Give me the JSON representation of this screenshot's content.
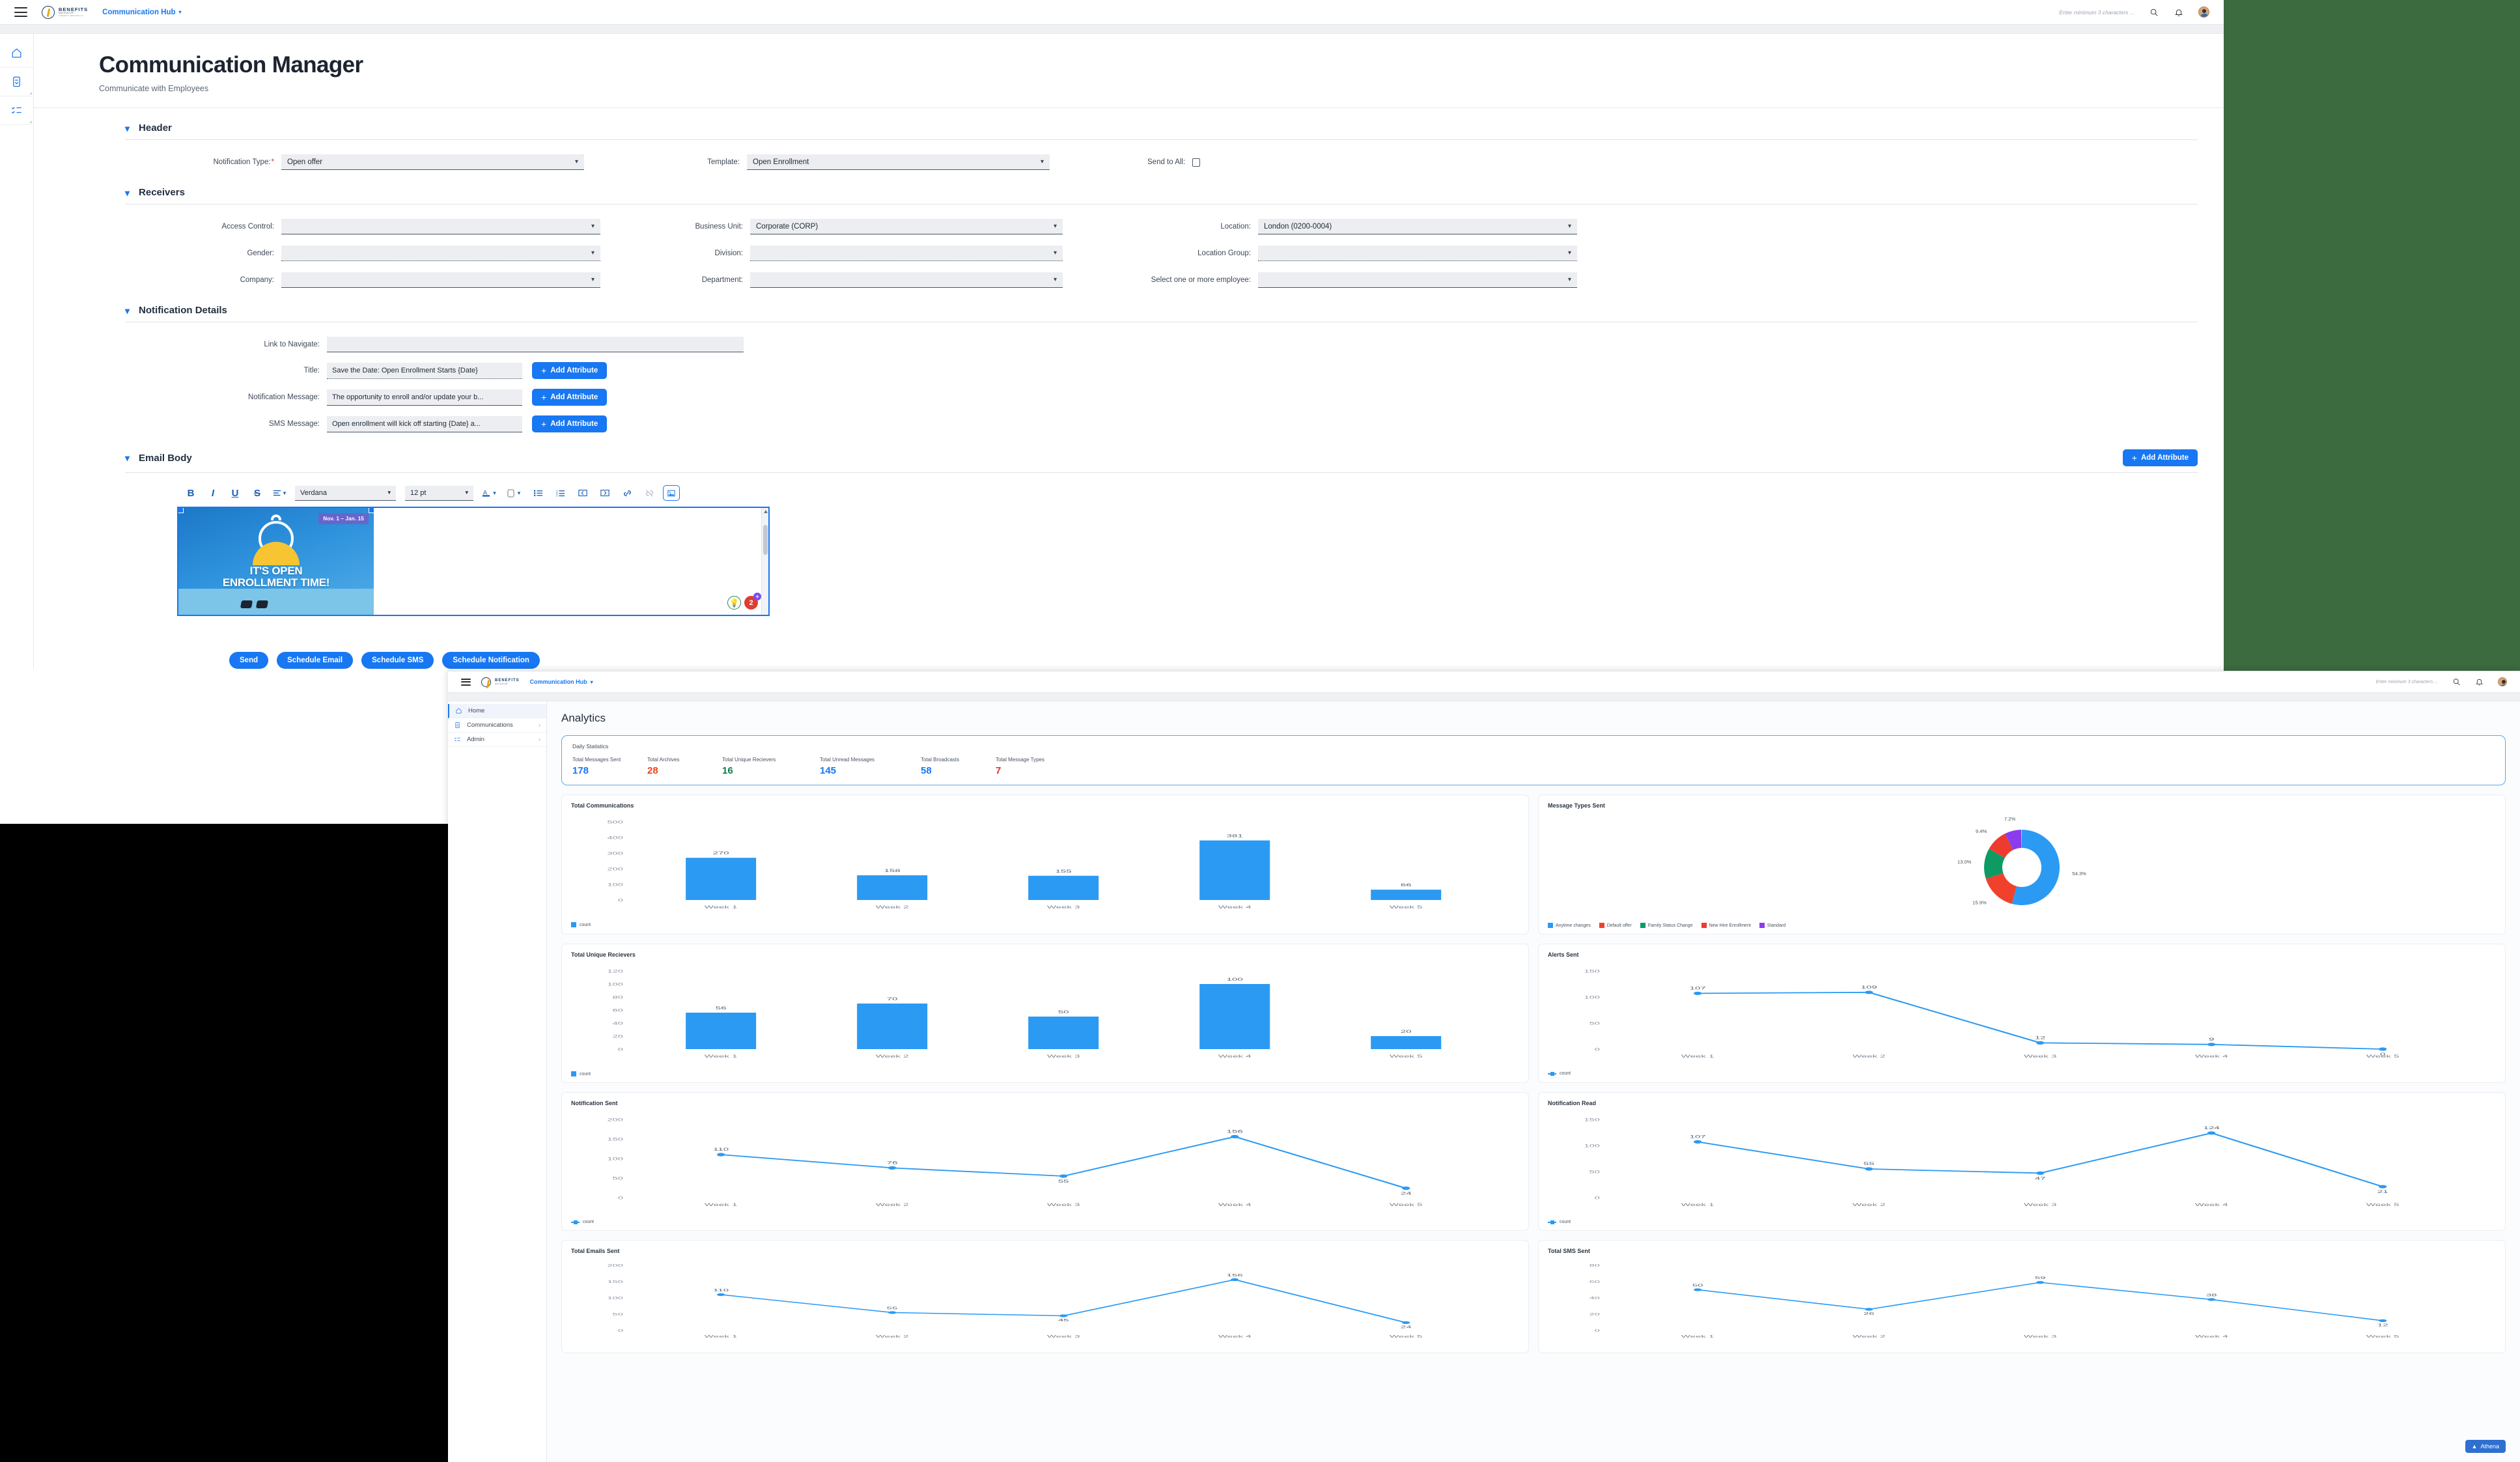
{
  "back_window": {
    "topbar": {
      "brand_line1": "BENEFITS",
      "brand_line2": "NAVIGATOR",
      "brand_line3": "A BENEFIT SERVICES CO",
      "hub_label": "Communication Hub",
      "search_placeholder": "Enter minimum 3 characters ..."
    },
    "page_title": "Communication Manager",
    "page_subtitle": "Communicate with Employees",
    "sections": {
      "header": "Header",
      "receivers": "Receivers",
      "notification_details": "Notification Details",
      "email_body": "Email Body"
    },
    "header_fields": {
      "notification_type_label": "Notification Type:",
      "notification_type_value": "Open offer",
      "template_label": "Template:",
      "template_value": "Open Enrollment",
      "send_to_all_label": "Send to All:"
    },
    "receivers_fields": {
      "access_control_label": "Access Control:",
      "access_control_value": "",
      "gender_label": "Gender:",
      "gender_value": "",
      "company_label": "Company:",
      "company_value": "",
      "business_unit_label": "Business Unit:",
      "business_unit_value": "Corporate (CORP)",
      "division_label": "Division:",
      "division_value": "",
      "department_label": "Department:",
      "department_value": "",
      "location_label": "Location:",
      "location_value": "London (0200-0004)",
      "location_group_label": "Location Group:",
      "location_group_value": "",
      "employee_label": "Select one or more employee:",
      "employee_value": ""
    },
    "notification_fields": {
      "link_label": "Link to Navigate:",
      "link_value": "",
      "title_label": "Title:",
      "title_value": "Save the Date: Open Enrollment Starts  {Date}",
      "notification_message_label": "Notification Message:",
      "notification_message_value": "The opportunity to enroll and/or update your b...",
      "sms_message_label": "SMS Message:",
      "sms_message_value": "Open enrollment will kick off starting  {Date} a...",
      "add_attribute": "Add Attribute"
    },
    "email_body": {
      "add_attribute": "Add Attribute",
      "font_family": "Verdana",
      "font_size": "12 pt",
      "banner_date": "Nov. 1 – Jan. 15",
      "banner_line1": "IT'S OPEN",
      "banner_line2": "ENROLLMENT TIME!",
      "fab_badge": "2"
    },
    "actions": [
      "Send",
      "Schedule Email",
      "Schedule SMS",
      "Schedule Notification"
    ]
  },
  "front_window": {
    "topbar": {
      "brand_line1": "BENEFITS",
      "brand_line2": "NAVIGATOR",
      "hub_label": "Communication Hub",
      "search_placeholder": "Enter minimum 3 characters ..."
    },
    "sidebar": [
      {
        "label": "Home",
        "icon": "home-icon",
        "arrow": "",
        "active": true
      },
      {
        "label": "Communications",
        "icon": "clipboard-icon",
        "arrow": "›",
        "active": false
      },
      {
        "label": "Admin",
        "icon": "checklist-icon",
        "arrow": "›",
        "active": false
      }
    ],
    "title": "Analytics",
    "daily_statistics": {
      "label": "Daily Statistics",
      "items": [
        {
          "label": "Total Messages Sent",
          "value": "178",
          "color": "#1877f2"
        },
        {
          "label": "Total Archives",
          "value": "28",
          "color": "#e8451f"
        },
        {
          "label": "Total Unique Recievers",
          "value": "16",
          "color": "#0e7a4d"
        },
        {
          "label": "Total Unread Messages",
          "value": "145",
          "color": "#1877f2"
        },
        {
          "label": "Total Broadcasts",
          "value": "58",
          "color": "#1877f2"
        },
        {
          "label": "Total Message Types",
          "value": "7",
          "color": "#d93025"
        }
      ]
    },
    "taskbar_button": "Athena"
  },
  "chart_data": [
    {
      "type": "bar",
      "title": "Total Communications",
      "categories": [
        "Week 1",
        "Week 2",
        "Week 3",
        "Week 4",
        "Week 5"
      ],
      "values": [
        270,
        158,
        155,
        381,
        66
      ],
      "yticks": [
        0,
        100,
        200,
        300,
        400,
        500
      ],
      "ylim": [
        0,
        500
      ],
      "legend": [
        "count"
      ],
      "legend_position": "bottom-left",
      "color": "#2b9af3",
      "xlabel": "",
      "ylabel": ""
    },
    {
      "type": "pie",
      "title": "Message Types Sent",
      "labels": [
        "Anytime changes",
        "Default offer",
        "Family Status Change",
        "New Hire Enrollment",
        "Standard"
      ],
      "values": [
        54.3,
        15.9,
        13.0,
        9.4,
        7.2
      ],
      "display": [
        "54.3%",
        "15.9%",
        "13.0%",
        "9.4%",
        "7.2%"
      ],
      "colors": [
        "#2b9af3",
        "#f0412c",
        "#0e9b63",
        "#ee3b30",
        "#8a3ded"
      ],
      "donut": true,
      "legend_position": "bottom-left"
    },
    {
      "type": "bar",
      "title": "Total Unique Recievers",
      "categories": [
        "Week 1",
        "Week 2",
        "Week 3",
        "Week 4",
        "Week 5"
      ],
      "values": [
        56,
        70,
        50,
        100,
        20
      ],
      "yticks": [
        0,
        20,
        40,
        60,
        80,
        100,
        120
      ],
      "ylim": [
        0,
        120
      ],
      "legend": [
        "count"
      ],
      "color": "#2b9af3"
    },
    {
      "type": "line",
      "title": "Alerts Sent",
      "categories": [
        "Week 1",
        "Week 2",
        "Week 3",
        "Week 4",
        "Week 5"
      ],
      "values": [
        107,
        109,
        12,
        9,
        0
      ],
      "yticks": [
        0,
        50,
        100,
        150
      ],
      "ylim": [
        0,
        150
      ],
      "legend": [
        "count"
      ],
      "color": "#2b9af3"
    },
    {
      "type": "line",
      "title": "Notification Sent",
      "categories": [
        "Week 1",
        "Week 2",
        "Week 3",
        "Week 4",
        "Week 5"
      ],
      "values": [
        110,
        76,
        55,
        156,
        24
      ],
      "yticks": [
        0,
        50,
        100,
        150,
        200
      ],
      "ylim": [
        0,
        200
      ],
      "legend": [
        "count"
      ],
      "color": "#2b9af3"
    },
    {
      "type": "line",
      "title": "Notification Read",
      "categories": [
        "Week 1",
        "Week 2",
        "Week 3",
        "Week 4",
        "Week 5"
      ],
      "values": [
        107,
        55,
        47,
        124,
        21
      ],
      "yticks": [
        0,
        50,
        100,
        150
      ],
      "ylim": [
        0,
        150
      ],
      "legend": [
        "count"
      ],
      "color": "#2b9af3"
    },
    {
      "type": "line",
      "title": "Total Emails Sent",
      "categories": [
        "Week 1",
        "Week 2",
        "Week 3",
        "Week 4",
        "Week 5"
      ],
      "values": [
        110,
        55,
        45,
        156,
        24
      ],
      "yticks": [
        0,
        50,
        100,
        150,
        200
      ],
      "ylim": [
        0,
        200
      ],
      "legend": [
        "count"
      ],
      "color": "#2b9af3"
    },
    {
      "type": "line",
      "title": "Total SMS Sent",
      "categories": [
        "Week 1",
        "Week 2",
        "Week 3",
        "Week 4",
        "Week 5"
      ],
      "values": [
        50,
        26,
        59,
        38,
        12
      ],
      "yticks": [
        0,
        20,
        40,
        60,
        80
      ],
      "ylim": [
        0,
        80
      ],
      "legend": [
        "count"
      ],
      "color": "#2b9af3"
    }
  ]
}
